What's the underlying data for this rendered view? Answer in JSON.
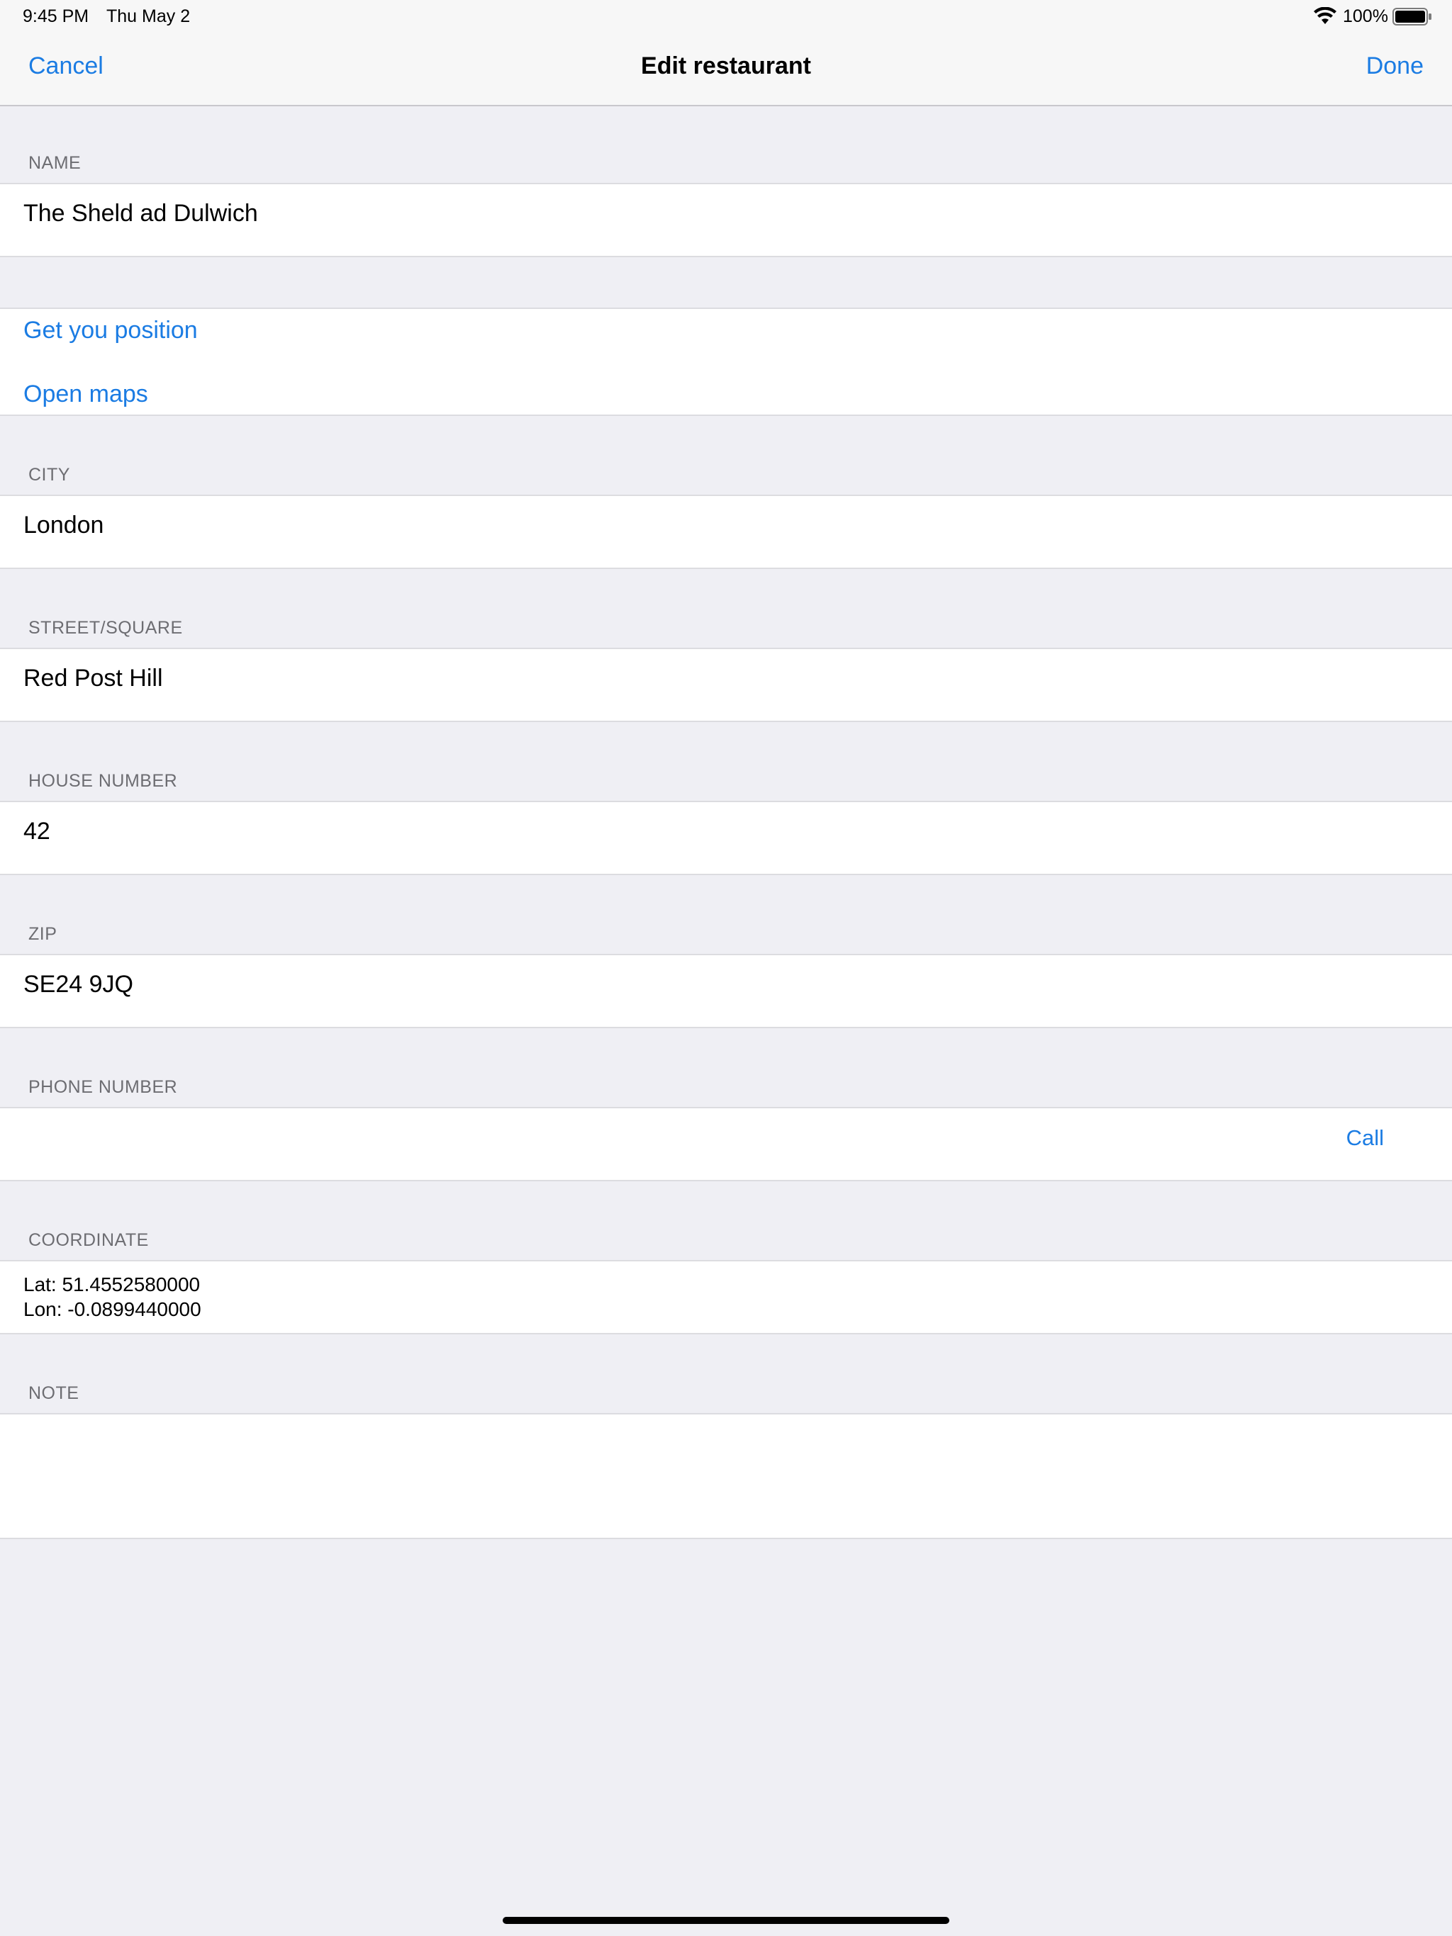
{
  "status_bar": {
    "time": "9:45 PM",
    "date": "Thu May 2",
    "battery": "100%"
  },
  "nav": {
    "cancel": "Cancel",
    "title": "Edit restaurant",
    "done": "Done"
  },
  "form": {
    "name": {
      "label": "NAME",
      "value": "The Sheld ad Dulwich"
    },
    "location_actions": {
      "get_position": "Get you position",
      "open_maps": "Open maps"
    },
    "city": {
      "label": "CITY",
      "value": "London"
    },
    "street": {
      "label": "STREET/SQUARE",
      "value": "Red Post Hill"
    },
    "house_number": {
      "label": "HOUSE NUMBER",
      "value": "42"
    },
    "zip": {
      "label": "ZIP",
      "value": "SE24 9JQ"
    },
    "phone": {
      "label": "PHONE NUMBER",
      "value": "",
      "call": "Call"
    },
    "coordinate": {
      "label": "COORDINATE",
      "lat": "Lat: 51.4552580000",
      "lon": "Lon: -0.0899440000"
    },
    "note": {
      "label": "NOTE",
      "value": ""
    }
  },
  "colors": {
    "accent": "#1b7ce3",
    "background": "#efeff4",
    "header_text": "#6d6d72"
  }
}
